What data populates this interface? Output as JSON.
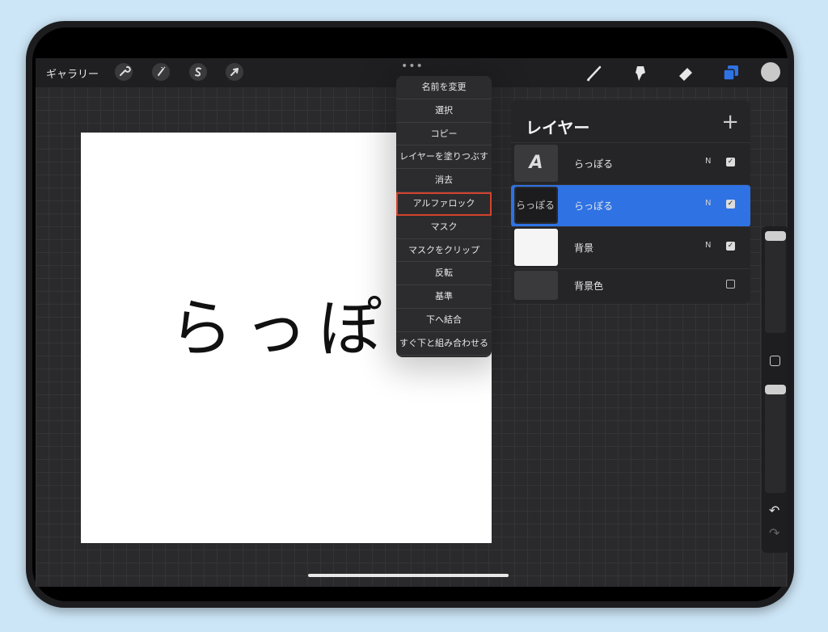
{
  "toolbar": {
    "gallery_label": "ギャラリー",
    "left_tools": [
      "wrench-icon",
      "magic-wand-icon",
      "selection-s-icon",
      "arrow-cursor-icon"
    ],
    "more_label": "•••",
    "right_tools": [
      "brush-icon",
      "smudge-icon",
      "eraser-icon",
      "layers-icon"
    ],
    "active_tool_color": "#2f72e4"
  },
  "canvas": {
    "text": "らっぽる"
  },
  "context_menu": {
    "items": [
      "名前を変更",
      "選択",
      "コピー",
      "レイヤーを塗りつぶす",
      "消去",
      "アルファロック",
      "マスク",
      "マスクをクリップ",
      "反転",
      "基準",
      "下へ結合",
      "すぐ下と組み合わせる"
    ],
    "highlighted": "アルファロック",
    "highlight_color": "#d2432c"
  },
  "layers_panel": {
    "title": "レイヤー",
    "add_label": "+",
    "layers": [
      {
        "thumb": "A",
        "name": "らっぽる",
        "mode": "N",
        "checked": true,
        "selected": false
      },
      {
        "thumb": "らっぽる",
        "name": "らっぽる",
        "mode": "N",
        "checked": true,
        "selected": true
      },
      {
        "thumb": "",
        "name": "背景",
        "mode": "N",
        "checked": true,
        "selected": false
      },
      {
        "thumb": "",
        "name": "背景色",
        "mode": "",
        "checked": false,
        "selected": false
      }
    ]
  },
  "sidebar": {
    "undo_icon": "undo-icon",
    "redo_icon": "redo-icon"
  }
}
